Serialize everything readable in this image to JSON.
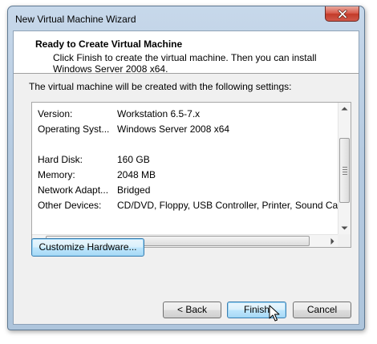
{
  "window": {
    "title": "New Virtual Machine Wizard"
  },
  "header": {
    "title": "Ready to Create Virtual Machine",
    "description": "Click Finish to create the virtual machine. Then you can install Windows Server 2008 x64."
  },
  "intro": "The virtual machine will be created with the following settings:",
  "settings": [
    {
      "label": "Version:",
      "value": "Workstation 6.5-7.x"
    },
    {
      "label": "Operating Syst...",
      "value": "Windows Server 2008 x64"
    },
    {
      "label": "",
      "value": ""
    },
    {
      "label": "Hard Disk:",
      "value": "160 GB"
    },
    {
      "label": "Memory:",
      "value": "2048 MB"
    },
    {
      "label": "Network Adapt...",
      "value": "Bridged"
    },
    {
      "label": "Other Devices:",
      "value": "CD/DVD, Floppy, USB Controller, Printer, Sound Card"
    }
  ],
  "buttons": {
    "customize": "Customize Hardware...",
    "back": "< Back",
    "finish": "Finish",
    "cancel": "Cancel"
  },
  "icons": {
    "close": "close-icon",
    "scroll_up": "arrow-up-icon",
    "scroll_down": "arrow-down-icon",
    "scroll_left": "arrow-left-icon",
    "scroll_right": "arrow-right-icon",
    "cursor": "mouse-cursor-icon"
  },
  "colors": {
    "frame": "#b6cbe1",
    "close_button": "#c23b29",
    "client_background": "#f0f0f0",
    "default_button": "#bee6fd"
  }
}
